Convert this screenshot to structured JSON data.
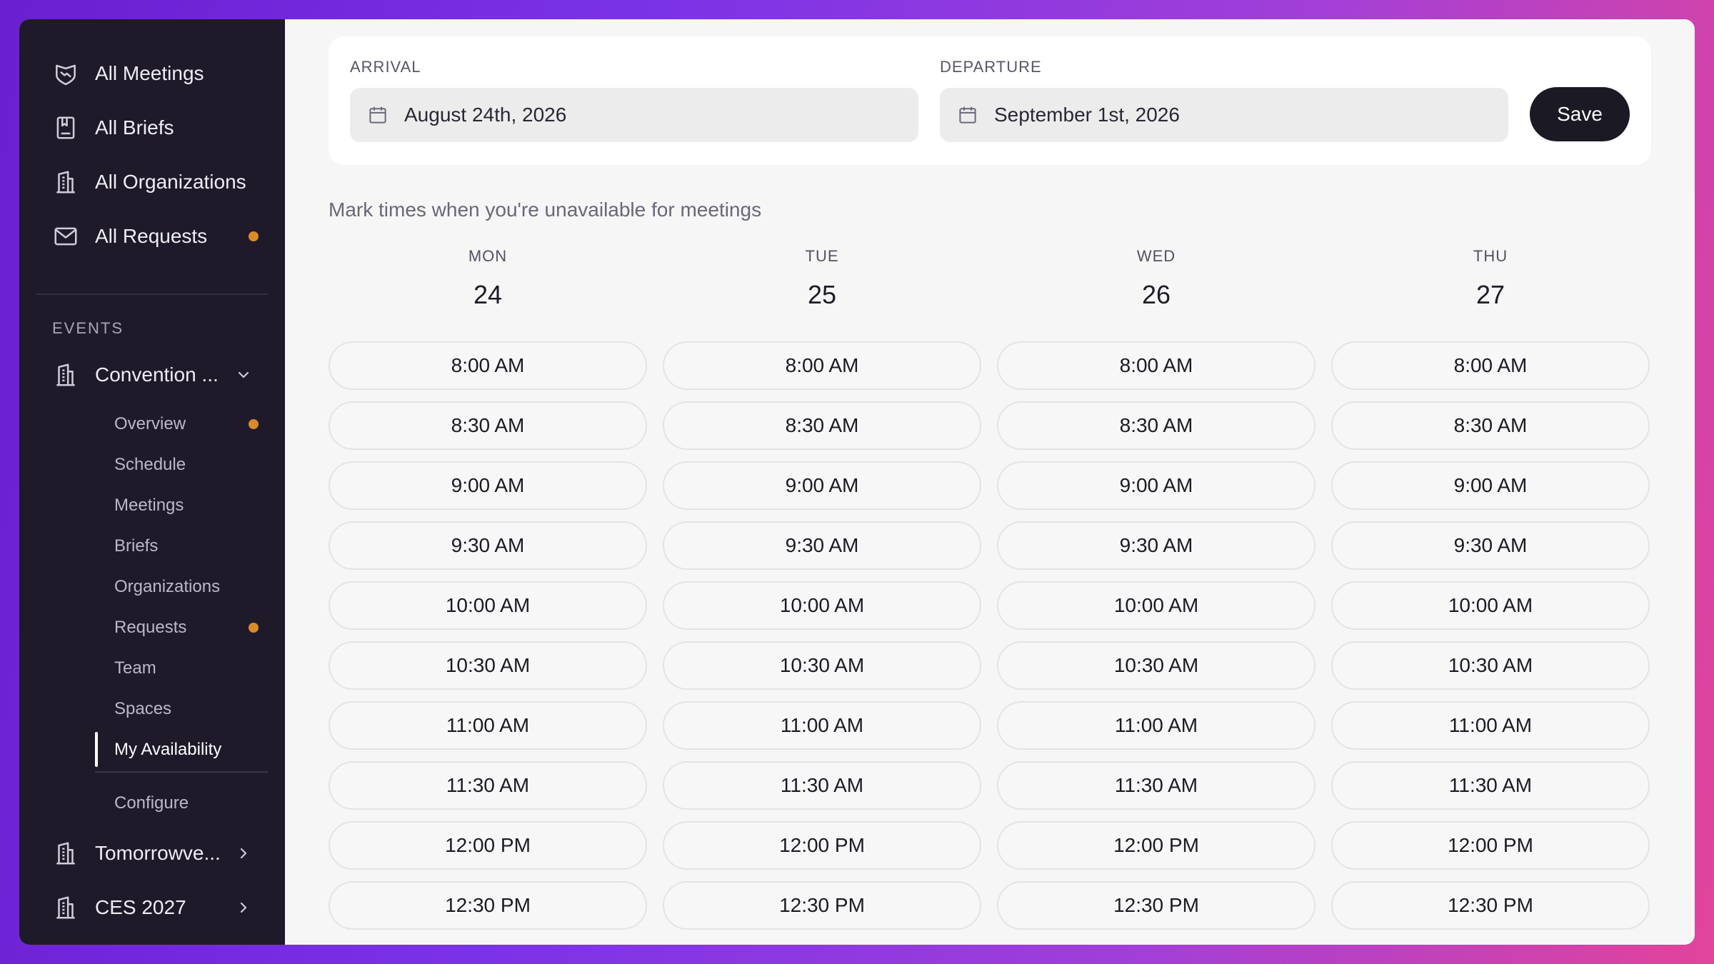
{
  "sidebar": {
    "top_items": [
      {
        "label": "All Meetings",
        "icon": "handshake-icon",
        "dot": false
      },
      {
        "label": "All Briefs",
        "icon": "notebook-icon",
        "dot": false
      },
      {
        "label": "All Organizations",
        "icon": "building-icon",
        "dot": false
      },
      {
        "label": "All Requests",
        "icon": "mail-icon",
        "dot": true
      }
    ],
    "section_label": "EVENTS",
    "events": [
      {
        "label": "Convention ...",
        "icon": "building-icon",
        "expanded": true
      },
      {
        "label": "Tomorrowve...",
        "icon": "building-icon",
        "expanded": false
      },
      {
        "label": "CES 2027",
        "icon": "building-icon",
        "expanded": false
      }
    ],
    "sub_items": [
      {
        "label": "Overview",
        "dot": true
      },
      {
        "label": "Schedule",
        "dot": false
      },
      {
        "label": "Meetings",
        "dot": false
      },
      {
        "label": "Briefs",
        "dot": false
      },
      {
        "label": "Organizations",
        "dot": false
      },
      {
        "label": "Requests",
        "dot": true
      },
      {
        "label": "Team",
        "dot": false
      },
      {
        "label": "Spaces",
        "dot": false
      },
      {
        "label": "My Availability",
        "dot": false,
        "active": true
      },
      {
        "label": "Configure",
        "dot": false
      }
    ],
    "dot_color": "#d98a2b"
  },
  "dates": {
    "arrival_label": "ARRIVAL",
    "arrival_value": "August 24th, 2026",
    "departure_label": "DEPARTURE",
    "departure_value": "September 1st, 2026",
    "save_label": "Save"
  },
  "helper_text": "Mark times when you're unavailable for meetings",
  "days": [
    {
      "dow": "MON",
      "num": "24"
    },
    {
      "dow": "TUE",
      "num": "25"
    },
    {
      "dow": "WED",
      "num": "26"
    },
    {
      "dow": "THU",
      "num": "27"
    }
  ],
  "slots": [
    "8:00 AM",
    "8:30 AM",
    "9:00 AM",
    "9:30 AM",
    "10:00 AM",
    "10:30 AM",
    "11:00 AM",
    "11:30 AM",
    "12:00 PM",
    "12:30 PM"
  ]
}
